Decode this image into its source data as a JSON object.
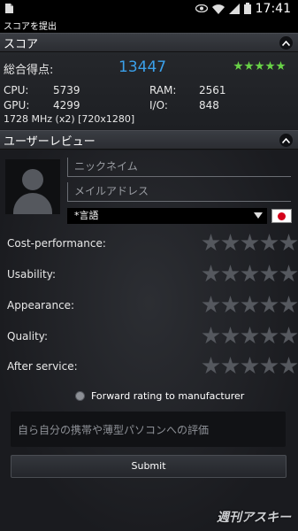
{
  "status_bar": {
    "time": "17:41",
    "icons": [
      "document-icon",
      "eye-icon",
      "wifi-icon",
      "signal-icon",
      "battery-icon"
    ]
  },
  "action_bar": {
    "title": "スコアを提出"
  },
  "score_section": {
    "title": "スコア",
    "total_label": "総合得点:",
    "total_value": "13447",
    "total_stars": 5,
    "cpu_label": "CPU:",
    "cpu_value": "5739",
    "ram_label": "RAM:",
    "ram_value": "2561",
    "gpu_label": "GPU:",
    "gpu_value": "4299",
    "io_label": "I/O:",
    "io_value": "848",
    "device_info": "1728 MHz (x2) [720x1280]"
  },
  "review_section": {
    "title": "ユーザーレビュー",
    "nickname_placeholder": "ニックネイム",
    "email_placeholder": "メイルアドレス",
    "language_label": "*言語",
    "ratings": [
      {
        "label": "Cost-performance:"
      },
      {
        "label": "Usability:"
      },
      {
        "label": "Appearance:"
      },
      {
        "label": "Quality:"
      },
      {
        "label": "After service:"
      }
    ],
    "forward_label": "Forward rating to manufacturer",
    "comment_placeholder": "自ら自分の携帯や薄型パソコンへの評価",
    "submit_label": "Submit"
  },
  "watermark": "週刊アスキー",
  "colors": {
    "score_blue": "#3aa0ea",
    "star_green": "#69d247",
    "star_grey": "#55585e",
    "flag_red": "#d4001a"
  }
}
